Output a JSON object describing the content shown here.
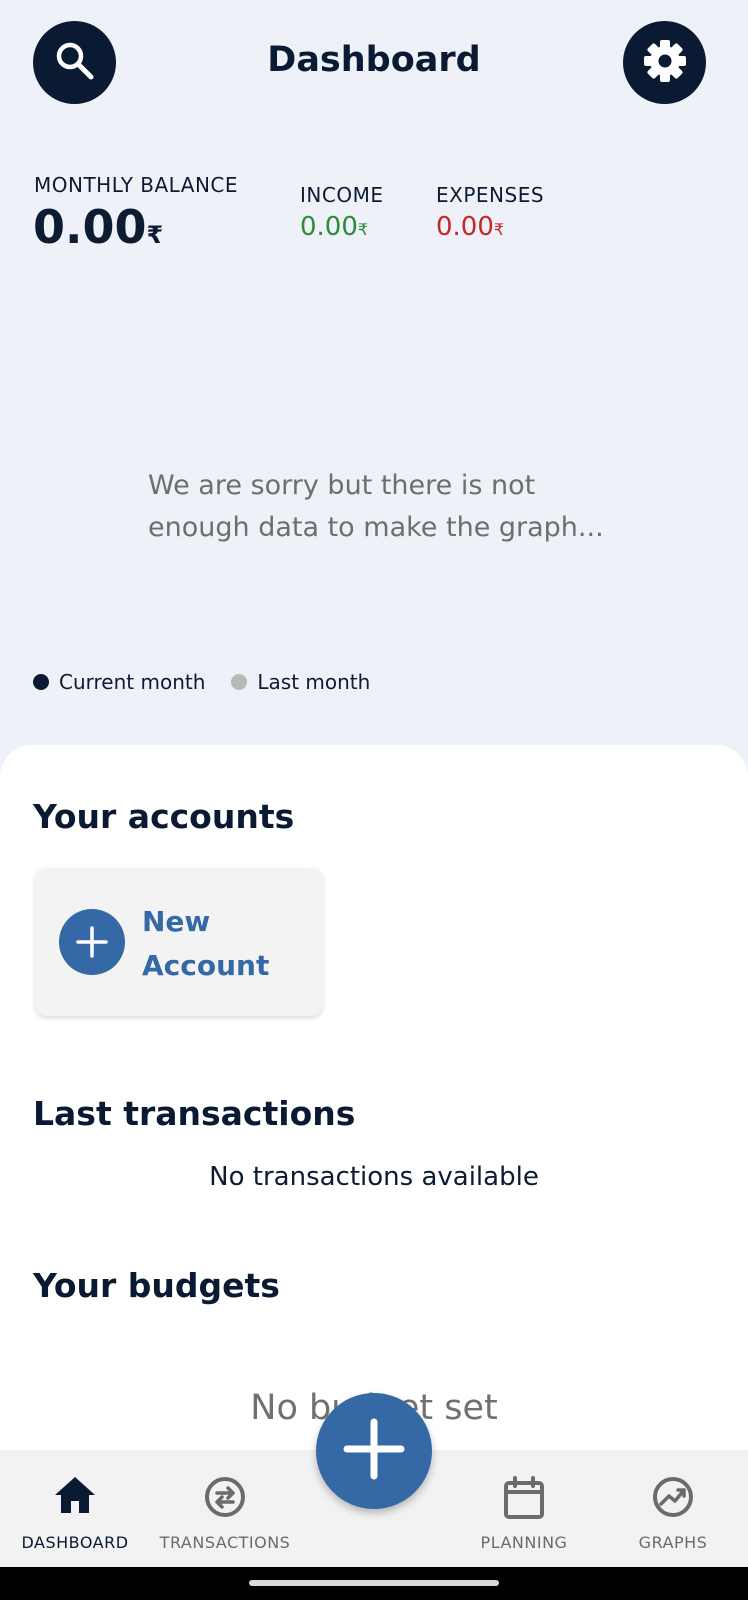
{
  "header": {
    "title": "Dashboard",
    "search_icon": "search-icon",
    "settings_icon": "gear-icon"
  },
  "summary": {
    "balance_label": "MONTHLY BALANCE",
    "balance_value": "0.00",
    "currency": "₹",
    "income_label": "INCOME",
    "income_value": "0.00",
    "income_color": "#2e8b3a",
    "expenses_label": "EXPENSES",
    "expenses_value": "0.00",
    "expenses_color": "#c62828"
  },
  "graph": {
    "empty_message": "We are sorry but there is not enough data to make the graph...",
    "legend": [
      {
        "label": "Current month",
        "color": "#0b1a33"
      },
      {
        "label": "Last month",
        "color": "#b8b8b8"
      }
    ]
  },
  "accounts": {
    "title": "Your accounts",
    "new_account_label_1": "New",
    "new_account_label_2": "Account"
  },
  "transactions": {
    "title": "Last transactions",
    "empty_message": "No transactions available"
  },
  "budgets": {
    "title": "Your budgets",
    "empty_message": "No budget set"
  },
  "nav": {
    "items": [
      {
        "label": "DASHBOARD",
        "icon": "home-icon"
      },
      {
        "label": "TRANSACTIONS",
        "icon": "transfer-icon"
      },
      {
        "label": "PLANNING",
        "icon": "calendar-icon"
      },
      {
        "label": "GRAPHS",
        "icon": "chart-icon"
      }
    ],
    "fab_icon": "plus-icon"
  },
  "colors": {
    "primary": "#0b1a33",
    "accent": "#3569a5",
    "background": "#eef2f8"
  }
}
